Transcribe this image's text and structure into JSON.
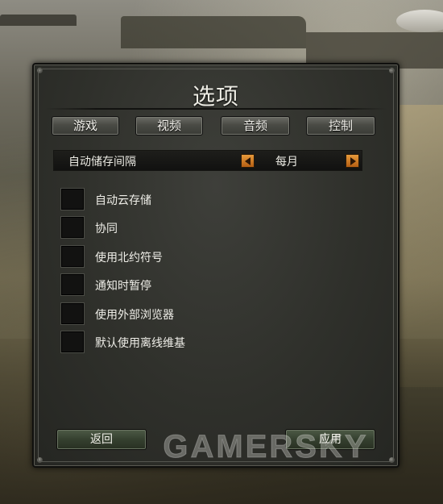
{
  "dialog": {
    "title": "选项",
    "tabs": [
      {
        "label": "游戏"
      },
      {
        "label": "视频"
      },
      {
        "label": "音频"
      },
      {
        "label": "控制"
      }
    ],
    "autosave": {
      "label": "自动储存间隔",
      "value": "每月",
      "prev_icon": "arrow-left-icon",
      "next_icon": "arrow-right-icon"
    },
    "options": [
      {
        "label": "自动云存储",
        "checked": false
      },
      {
        "label": "协同",
        "checked": false
      },
      {
        "label": "使用北约符号",
        "checked": false
      },
      {
        "label": "通知时暂停",
        "checked": false
      },
      {
        "label": "使用外部浏览器",
        "checked": false
      },
      {
        "label": "默认使用离线维基",
        "checked": false
      }
    ],
    "back_label": "返回",
    "apply_label": "应用"
  },
  "watermark": "GAMERSKY",
  "colors": {
    "arrow_accent": "#d9822b",
    "panel": "#2f302b",
    "button_green": "#35402f"
  }
}
